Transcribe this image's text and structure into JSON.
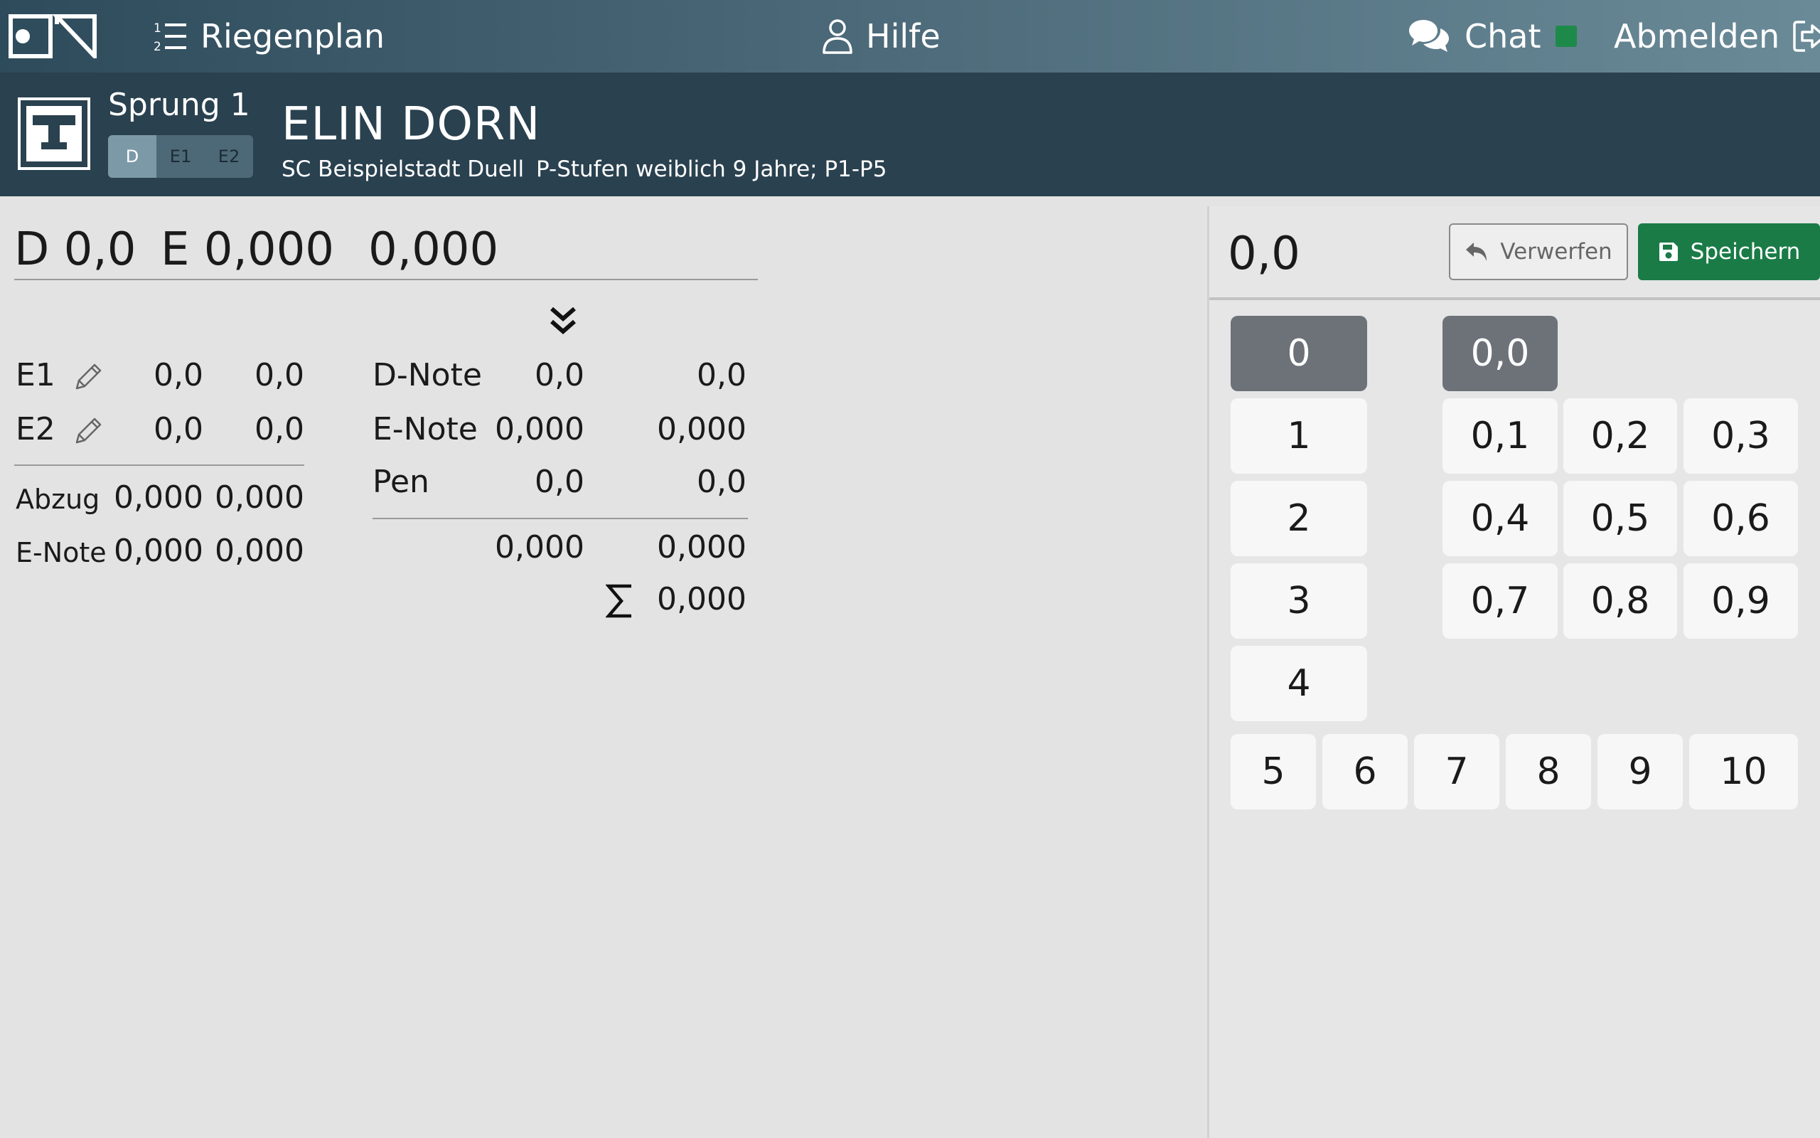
{
  "nav": {
    "riegenplan": "Riegenplan",
    "hilfe": "Hilfe",
    "chat": "Chat",
    "abmelden": "Abmelden",
    "status_color": "#1e8a4a"
  },
  "athlete": {
    "apparatus": "Sprung 1",
    "name": "ELIN DORN",
    "club": "SC Beispielstadt Duell",
    "category": "P-Stufen weiblich 9 Jahre; P1-P5",
    "judge_tabs": [
      "D",
      "E1",
      "E2"
    ],
    "active_judge_tab": "D"
  },
  "summary": {
    "d": "D 0,0",
    "e": "E 0,000",
    "total": "0,000"
  },
  "e_judges": {
    "rows": [
      {
        "label": "E1",
        "v1": "0,0",
        "v2": "0,0"
      },
      {
        "label": "E2",
        "v1": "0,0",
        "v2": "0,0"
      }
    ],
    "abzug": {
      "label": "Abzug",
      "v1": "0,000",
      "v2": "0,000"
    },
    "enote": {
      "label": "E-Note",
      "v1": "0,000",
      "v2": "0,000"
    }
  },
  "notes": {
    "rows": [
      {
        "label": "D-Note",
        "v1": "0,0",
        "v2": "0,0"
      },
      {
        "label": "E-Note",
        "v1": "0,000",
        "v2": "0,000"
      },
      {
        "label": "Pen",
        "v1": "0,0",
        "v2": "0,0"
      }
    ],
    "subtotal": {
      "v1": "0,000",
      "v2": "0,000"
    },
    "sum": "0,000"
  },
  "keypad": {
    "current_value": "0,0",
    "discard_label": "Verwerfen",
    "save_label": "Speichern",
    "integers_left": [
      "0",
      "1",
      "2",
      "3",
      "4"
    ],
    "decimals": [
      "0,0",
      "0,1",
      "0,2",
      "0,3",
      "0,4",
      "0,5",
      "0,6",
      "0,7",
      "0,8",
      "0,9"
    ],
    "integers_bottom": [
      "5",
      "6",
      "7",
      "8",
      "9",
      "10"
    ],
    "selected_integer": "0",
    "selected_decimal": "0,0"
  },
  "icons": {
    "logo": "brand-logo",
    "riegenplan": "ordered-list-icon",
    "hilfe": "user-icon",
    "chat": "comments-icon",
    "abmelden": "sign-out-icon",
    "apparatus": "apparatus-icon",
    "collapse": "double-chevron-down-icon",
    "edit": "pencil-icon",
    "discard": "undo-icon",
    "save": "floppy-disk-icon",
    "sum": "sigma-icon"
  }
}
